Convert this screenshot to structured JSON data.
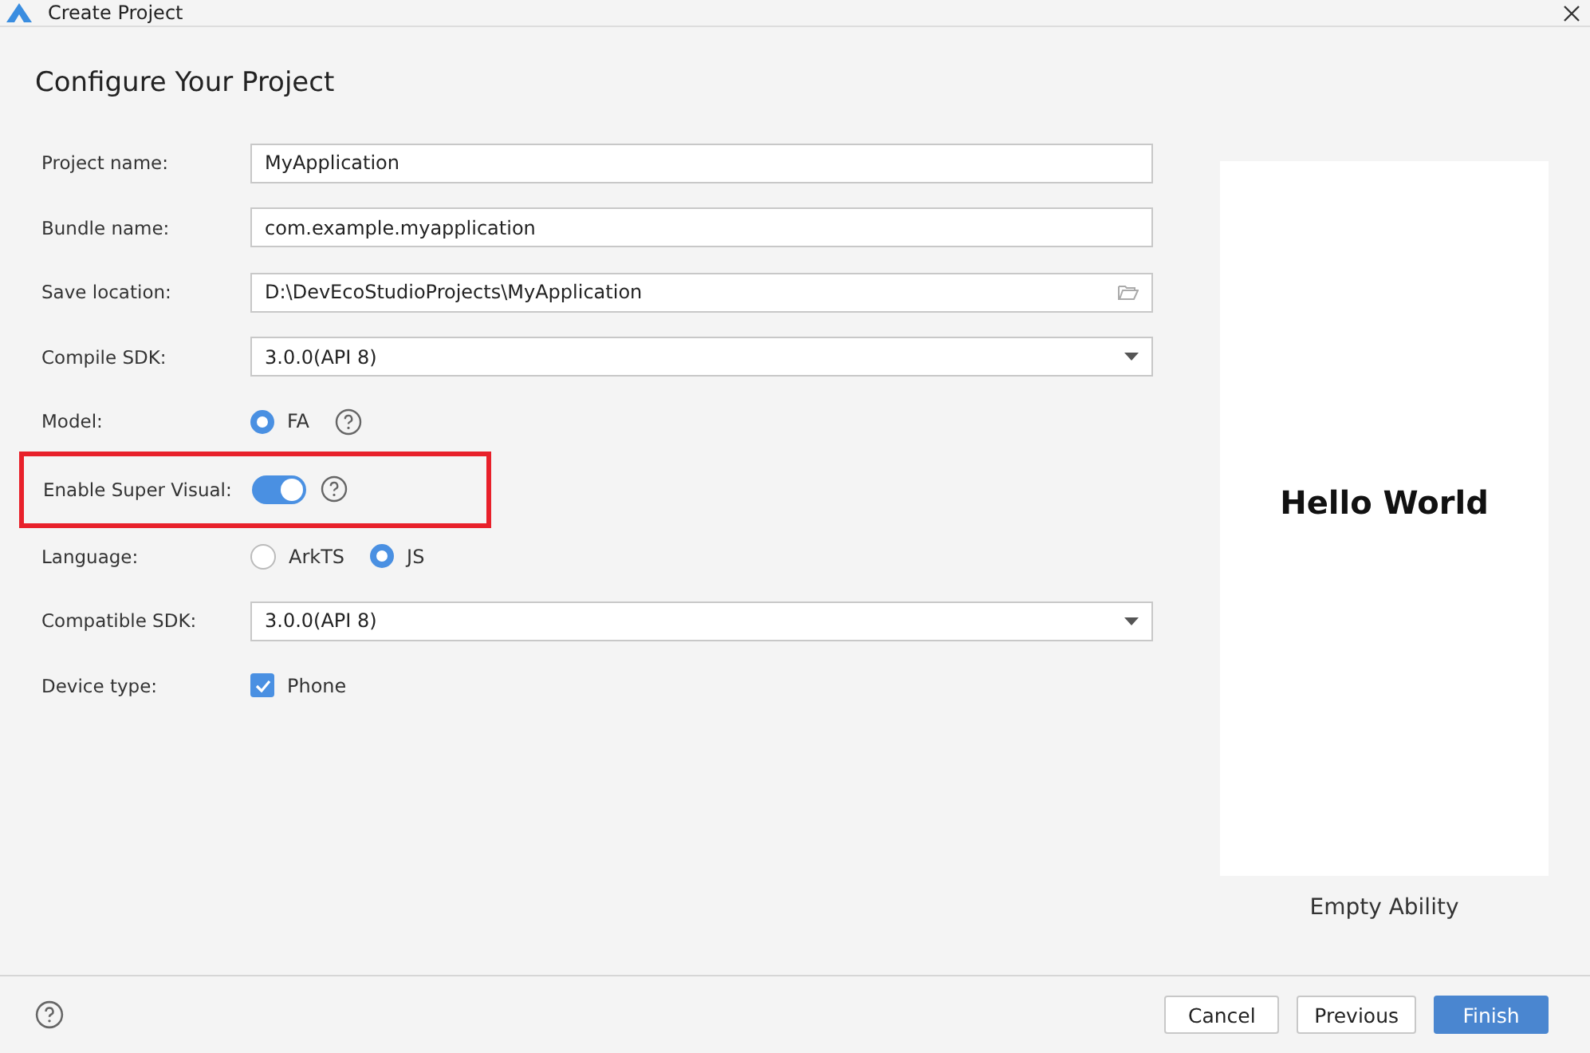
{
  "window": {
    "title": "Create Project"
  },
  "heading": "Configure Your Project",
  "fields": [
    {
      "kind": "text",
      "label": "Project name:",
      "value": "MyApplication"
    },
    {
      "kind": "text",
      "label": "Bundle name:",
      "value": "com.example.myapplication"
    },
    {
      "kind": "folder",
      "label": "Save location:",
      "value": "D:\\DevEcoStudioProjects\\MyApplication"
    },
    {
      "kind": "select",
      "label": "Compile SDK:",
      "value": "3.0.0(API 8)"
    },
    {
      "kind": "radio",
      "label": "Model:",
      "help": true,
      "options": [
        {
          "label": "FA",
          "selected": true
        }
      ]
    },
    {
      "kind": "switch",
      "label": "Enable Super Visual:",
      "on": true,
      "help": true,
      "highlighted": true
    },
    {
      "kind": "radio",
      "label": "Language:",
      "options": [
        {
          "label": "ArkTS",
          "selected": false
        },
        {
          "label": "JS",
          "selected": true
        }
      ]
    },
    {
      "kind": "select",
      "label": "Compatible SDK:",
      "value": "3.0.0(API 8)"
    },
    {
      "kind": "checkbox",
      "label": "Device type:",
      "checked": true,
      "text": "Phone"
    }
  ],
  "preview": {
    "text": "Hello World",
    "caption": "Empty Ability"
  },
  "buttons": [
    {
      "label": "Cancel",
      "primary": false
    },
    {
      "label": "Previous",
      "primary": false
    },
    {
      "label": "Finish",
      "primary": true
    }
  ]
}
